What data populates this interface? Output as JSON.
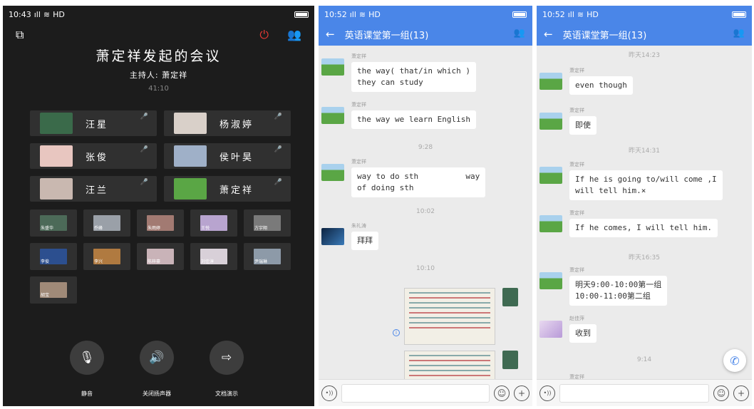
{
  "meeting": {
    "status": {
      "time": "10:43",
      "signal": "4G",
      "network": "HD"
    },
    "title": "萧定祥发起的会议",
    "host": "主持人: 萧定祥",
    "duration": "41:10",
    "participants": [
      {
        "name": "汪星",
        "mic": "🎤",
        "avatar": "#3a6a4a"
      },
      {
        "name": "杨淑婷",
        "mic": "🎤",
        "avatar": "#d9d0c9"
      },
      {
        "name": "张俊",
        "mic": "🎤",
        "avatar": "#e8c6c0"
      },
      {
        "name": "侯叶昊",
        "mic": "🎤",
        "avatar": "#9fb0c8"
      },
      {
        "name": "汪兰",
        "mic": "🎤",
        "avatar": "#c9b8b0"
      },
      {
        "name": "萧定祥",
        "mic": "🎤",
        "avatar": "#5aa645"
      }
    ],
    "small_participants": [
      {
        "label": "朱盛华",
        "color": "#4c6a58"
      },
      {
        "label": "乔峰",
        "color": "#9aa0a8"
      },
      {
        "label": "朱雨婷",
        "color": "#a27a72"
      },
      {
        "label": "王悦",
        "color": "#b8a4cf"
      },
      {
        "label": "方宇翔",
        "color": "#7a7a7a"
      },
      {
        "label": "李俊",
        "color": "#2c4f8f"
      },
      {
        "label": "李兴",
        "color": "#b07a40"
      },
      {
        "label": "陈梓豪",
        "color": "#c9b3b8"
      },
      {
        "label": "刘佳淳",
        "color": "#d8d0d8"
      },
      {
        "label": "尹瑞琳",
        "color": "#8d9aa8"
      },
      {
        "label": "胡宝",
        "color": "#a08a78"
      }
    ],
    "controls": [
      {
        "label": "静音",
        "icon": "🎙"
      },
      {
        "label": "关闭扬声器",
        "icon": "🔊"
      },
      {
        "label": "文档演示",
        "icon": "⇨"
      }
    ]
  },
  "chat1": {
    "status": {
      "time": "10:52",
      "signal": "4G",
      "network": "HD"
    },
    "title": "英语课堂第一组(13)",
    "messages": [
      {
        "sender": "萧定祥",
        "text": "the way( that/in which )\nthey can study"
      },
      {
        "sender": "萧定祥",
        "text": "the way we learn English"
      },
      {
        "timestamp": "9:28"
      },
      {
        "sender": "萧定祥",
        "text": "way to do sth          way\nof doing sth"
      },
      {
        "timestamp": "10:02"
      },
      {
        "sender": "朱礼涛",
        "text": "拜拜"
      },
      {
        "timestamp": "10:10"
      }
    ]
  },
  "chat2": {
    "status": {
      "time": "10:52",
      "signal": "4G",
      "network": "HD"
    },
    "title": "英语课堂第一组(13)",
    "messages": [
      {
        "timestamp": "昨天14:23"
      },
      {
        "sender": "萧定祥",
        "text": "even though"
      },
      {
        "sender": "萧定祥",
        "text": "即使"
      },
      {
        "timestamp": "昨天14:31"
      },
      {
        "sender": "萧定祥",
        "text": "If he is going to/will come ,I\nwill tell him.×"
      },
      {
        "sender": "萧定祥",
        "text": "If he comes, I will tell him."
      },
      {
        "timestamp": "昨天16:35"
      },
      {
        "sender": "萧定祥",
        "text": "明天9:00-10:00第一组\n10:00-11:00第二组"
      },
      {
        "sender": "赵佳萍",
        "text": "收到"
      },
      {
        "timestamp": "9:14"
      },
      {
        "sender": "萧定祥"
      }
    ]
  }
}
